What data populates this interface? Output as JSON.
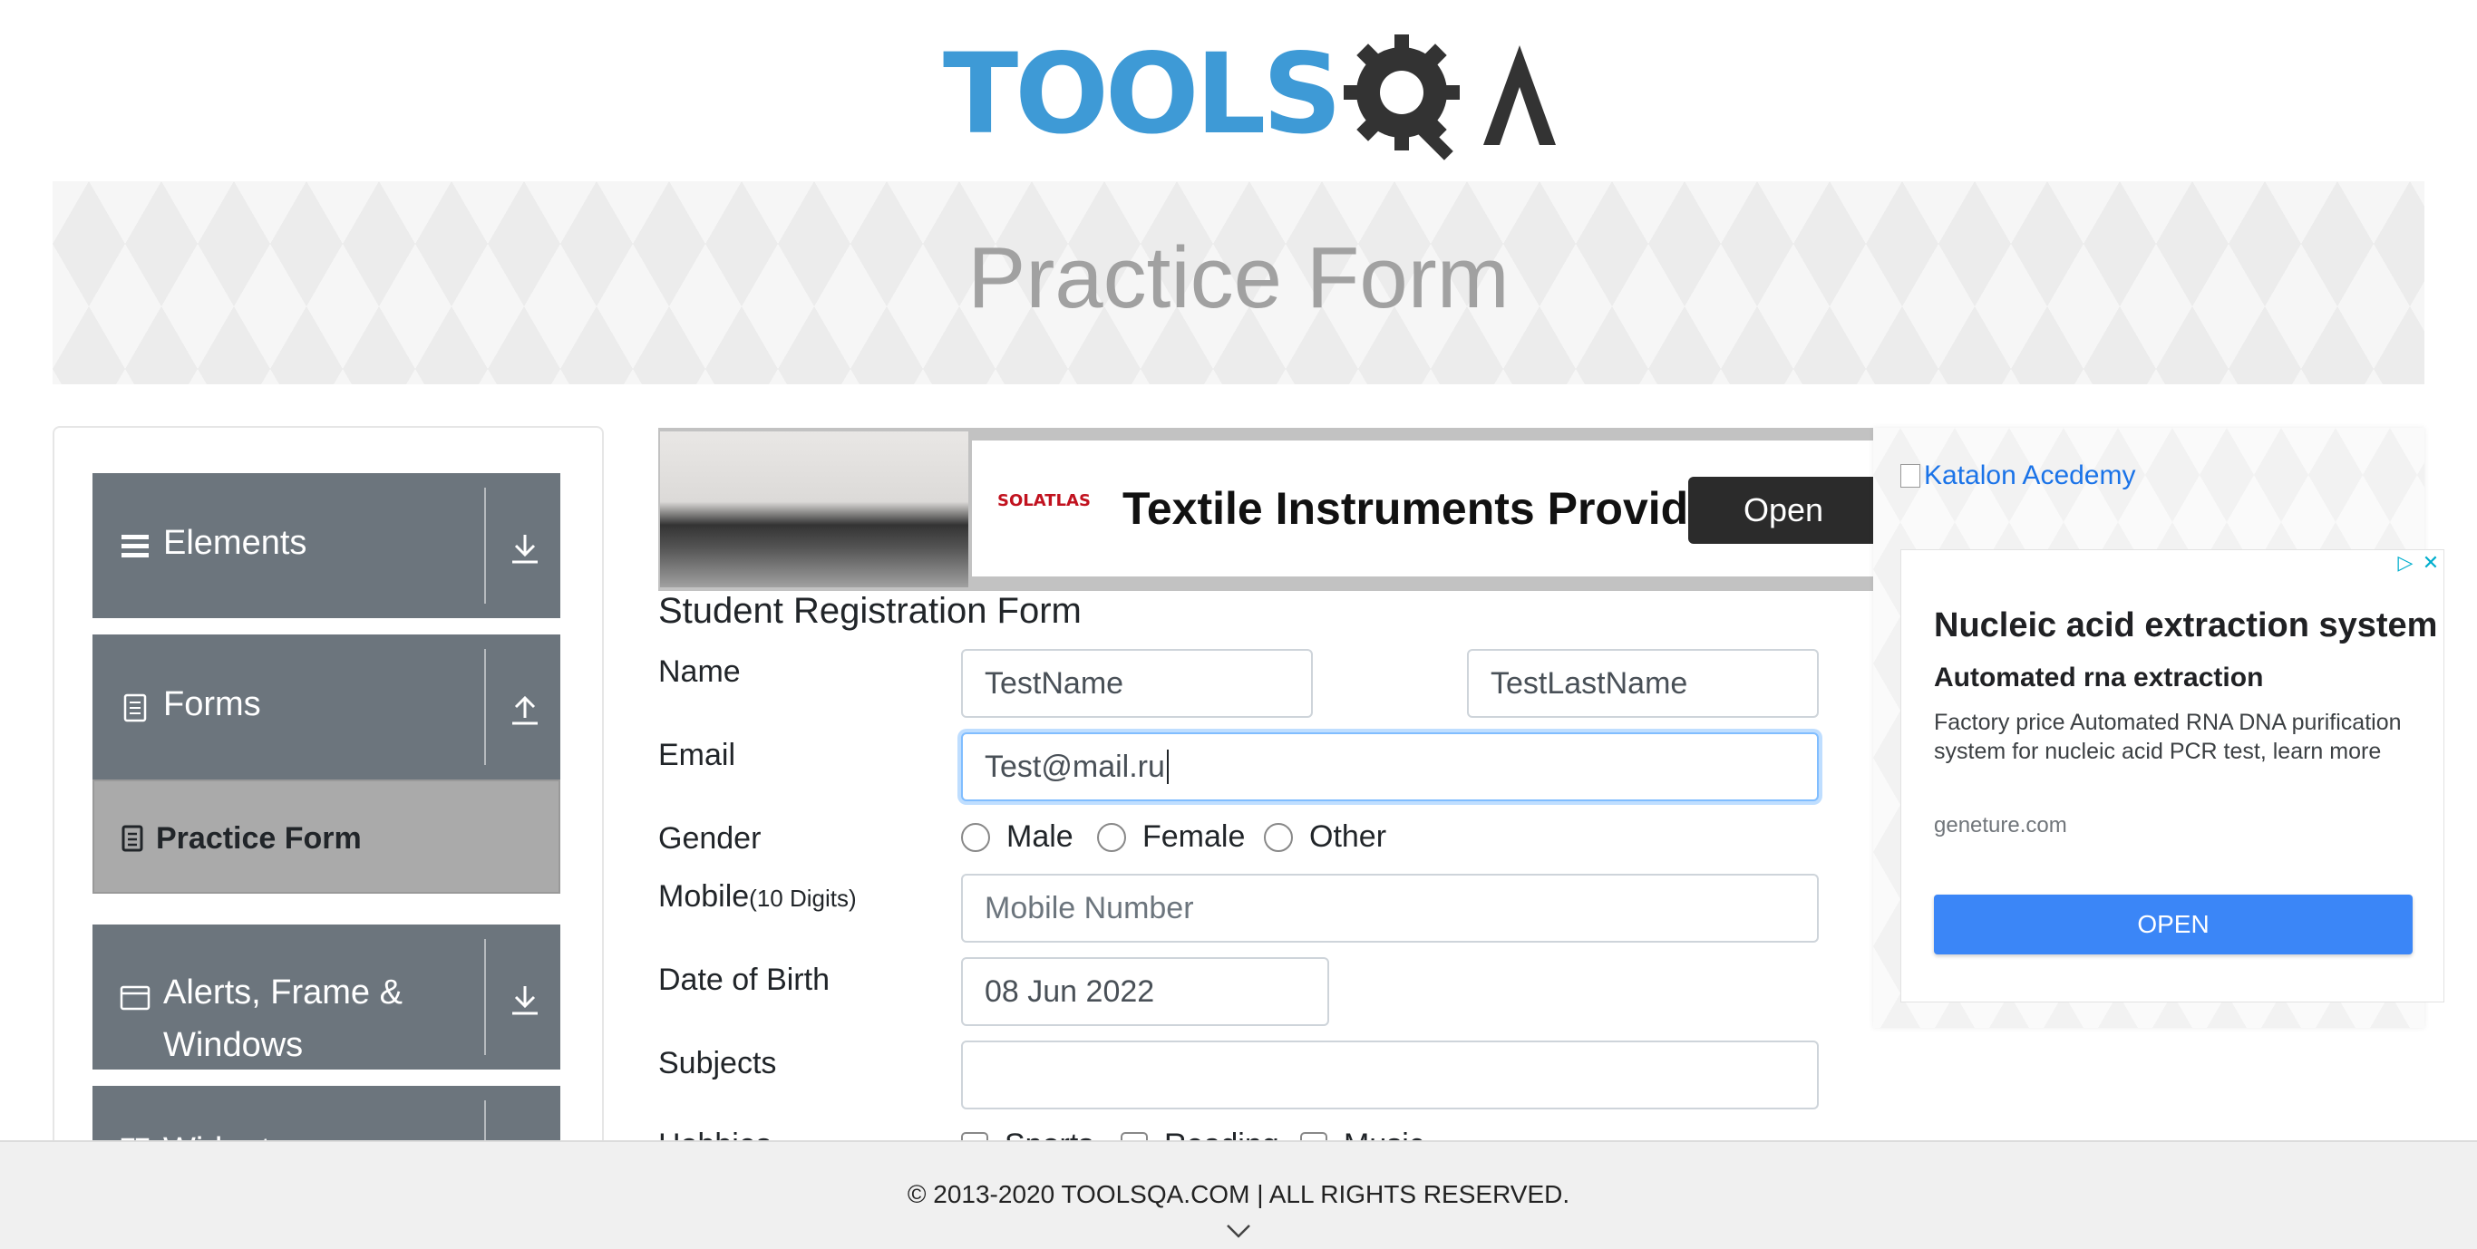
{
  "header": {
    "logo_text_left": "TOOLS",
    "logo_text_right": "QA",
    "logo_colors": {
      "tools": "#3e9ad6",
      "qa": "#333333"
    }
  },
  "banner": {
    "title": "Practice Form"
  },
  "sidebar": {
    "groups": [
      {
        "label": "Elements",
        "icon": "hamburger-icon",
        "arrow": "download-icon"
      },
      {
        "label": "Forms",
        "icon": "document-icon",
        "arrow": "upload-icon"
      },
      {
        "label": "Alerts, Frame &",
        "label_line2": "Windows",
        "icon": "window-icon",
        "arrow": "download-icon"
      },
      {
        "label": "Widgets",
        "icon": "widget-icon",
        "arrow": "download-icon"
      }
    ],
    "active_item": {
      "label": "Practice Form",
      "icon": "form-icon"
    }
  },
  "top_ad": {
    "brand": "SOLATLAS",
    "headline": "Textile Instruments Provider",
    "button": "Open"
  },
  "form": {
    "title": "Student Registration Form",
    "name_label": "Name",
    "first_name_value": "TestName",
    "last_name_value": "TestLastName",
    "email_label": "Email",
    "email_value": "Test@mail.ru",
    "gender_label": "Gender",
    "gender_options": [
      "Male",
      "Female",
      "Other"
    ],
    "mobile_label": "Mobile",
    "mobile_hint": "(10 Digits)",
    "mobile_placeholder": "Mobile Number",
    "dob_label": "Date of Birth",
    "dob_value": "08 Jun 2022",
    "subjects_label": "Subjects",
    "subjects_value": "",
    "hobbies_label": "Hobbies",
    "hobbies_options": [
      "Sports",
      "Reading",
      "Music"
    ]
  },
  "right_ad": {
    "image_alt": "Katalon Acedemy",
    "headline": "Nucleic acid extraction system",
    "subheadline": "Automated rna extraction",
    "body": "Factory price Automated RNA DNA purification system for nucleic acid PCR test, learn more",
    "domain": "geneture.com",
    "cta": "OPEN",
    "cta_color": "#3b86f7"
  },
  "footer": {
    "text": "© 2013-2020 TOOLSQA.COM | ALL RIGHTS RESERVED."
  }
}
